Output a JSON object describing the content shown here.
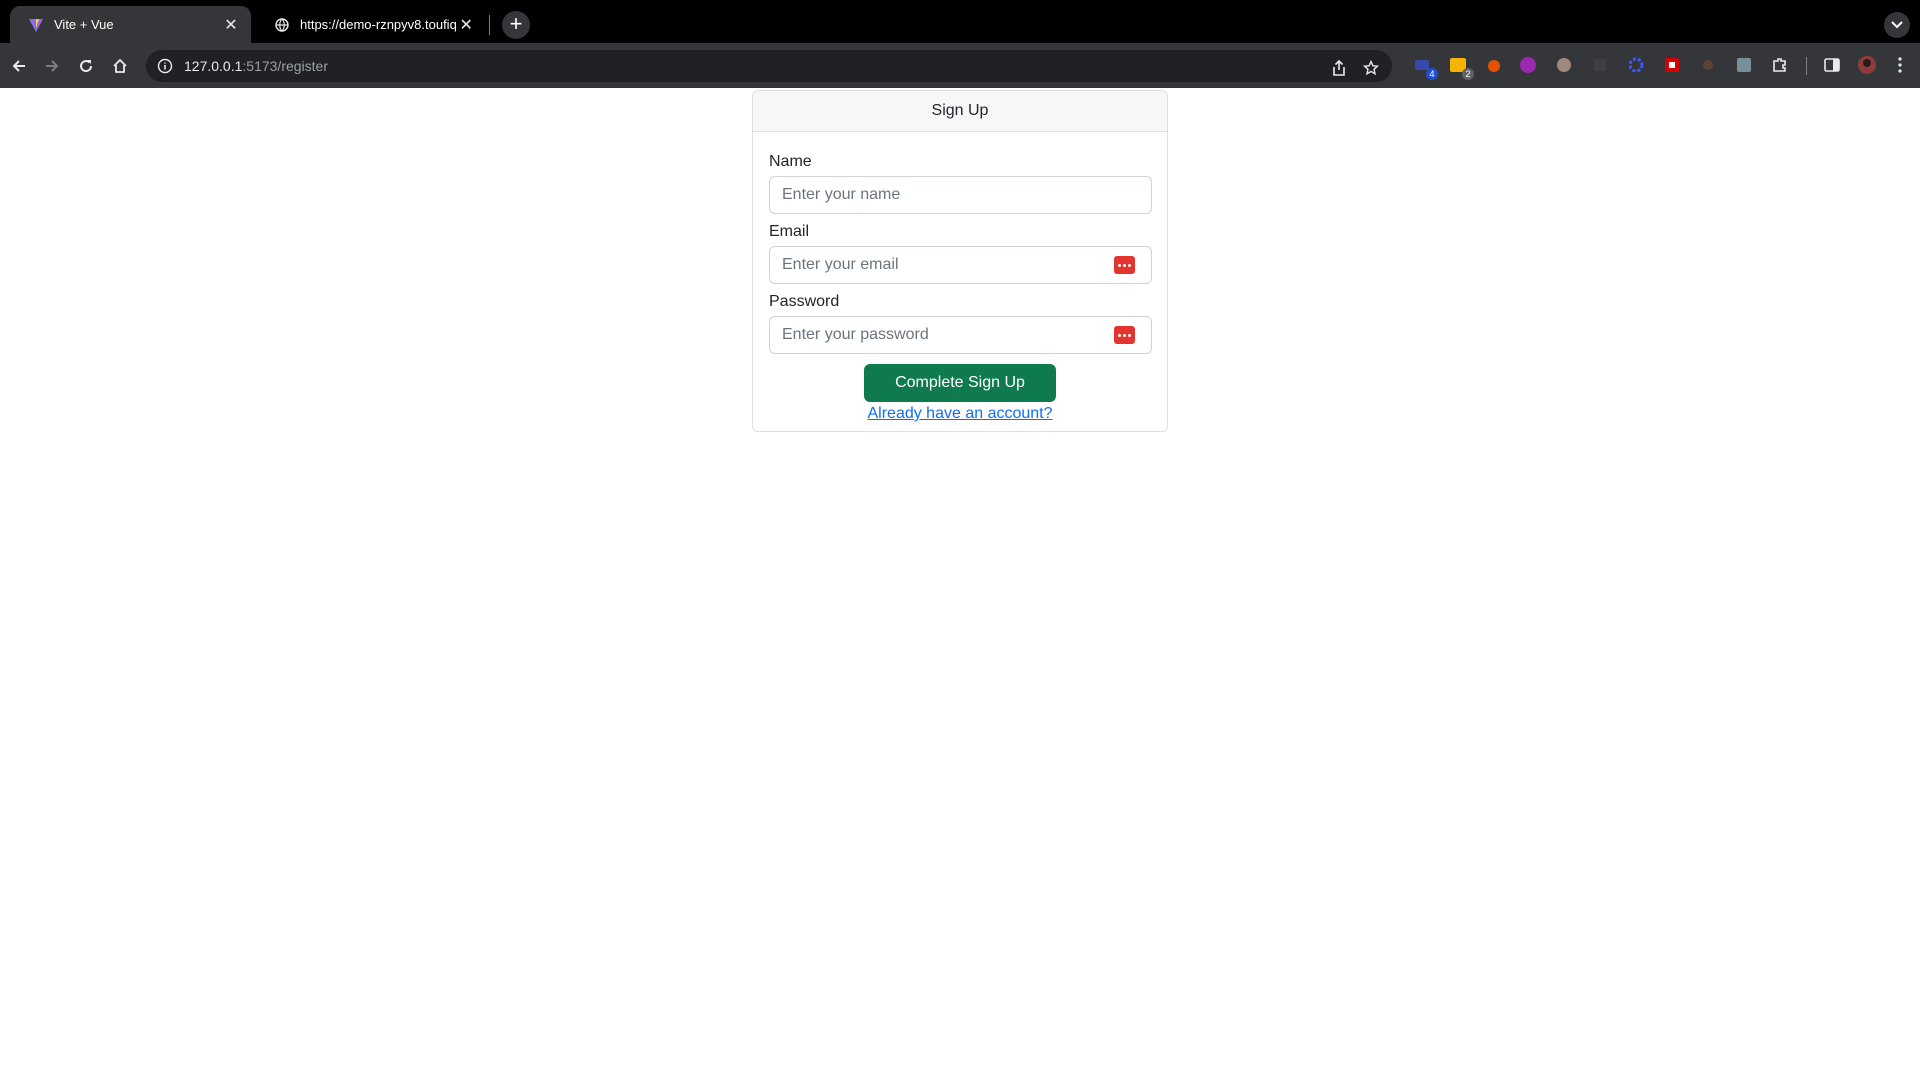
{
  "browser": {
    "tabs": [
      {
        "title": "Vite + Vue",
        "active": true
      },
      {
        "title": "https://demo-rznpyv8.toufiq.",
        "active": false
      }
    ],
    "new_tab_label": "+",
    "url_host": "127.0.0.1",
    "url_path": ":5173/register",
    "extension_badges": {
      "ext1": "4",
      "ext2": "2"
    }
  },
  "card": {
    "header": "Sign Up",
    "fields": {
      "name": {
        "label": "Name",
        "placeholder": "Enter your name",
        "value": ""
      },
      "email": {
        "label": "Email",
        "placeholder": "Enter your email",
        "value": ""
      },
      "password": {
        "label": "Password",
        "placeholder": "Enter your password",
        "value": ""
      }
    },
    "submit_label": "Complete Sign Up",
    "login_link": "Already have an account?"
  },
  "colors": {
    "primary_button": "#0f7a4d",
    "link": "#0d6efd",
    "password_manager_icon": "#e3342f"
  }
}
